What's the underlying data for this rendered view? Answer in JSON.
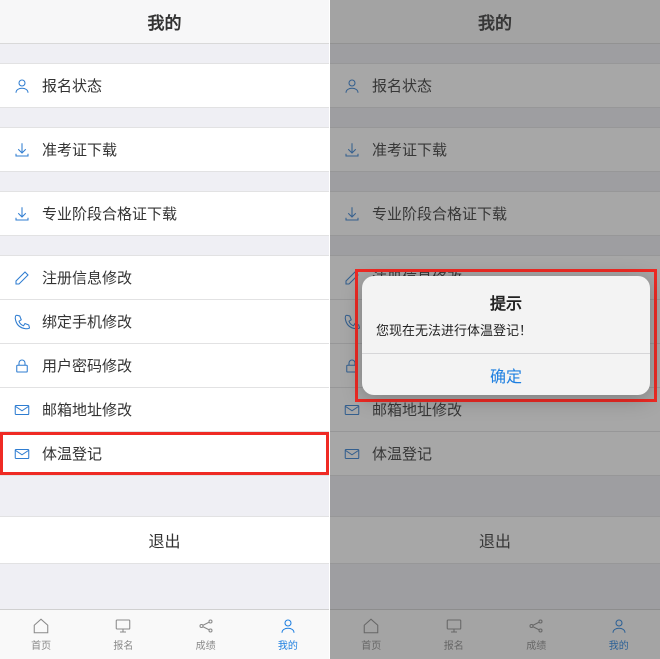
{
  "header": {
    "title": "我的"
  },
  "items": {
    "signup_status": "报名状态",
    "admission_download": "准考证下载",
    "cert_download": "专业阶段合格证下载",
    "reg_info_edit": "注册信息修改",
    "phone_edit": "绑定手机修改",
    "pwd_edit": "用户密码修改",
    "email_edit": "邮箱地址修改",
    "temp_register": "体温登记"
  },
  "logout": "退出",
  "tabs": {
    "home": "首页",
    "signup": "报名",
    "score": "成绩",
    "mine": "我的"
  },
  "dialog": {
    "title": "提示",
    "message": "您现在无法进行体温登记！",
    "ok": "确定"
  }
}
